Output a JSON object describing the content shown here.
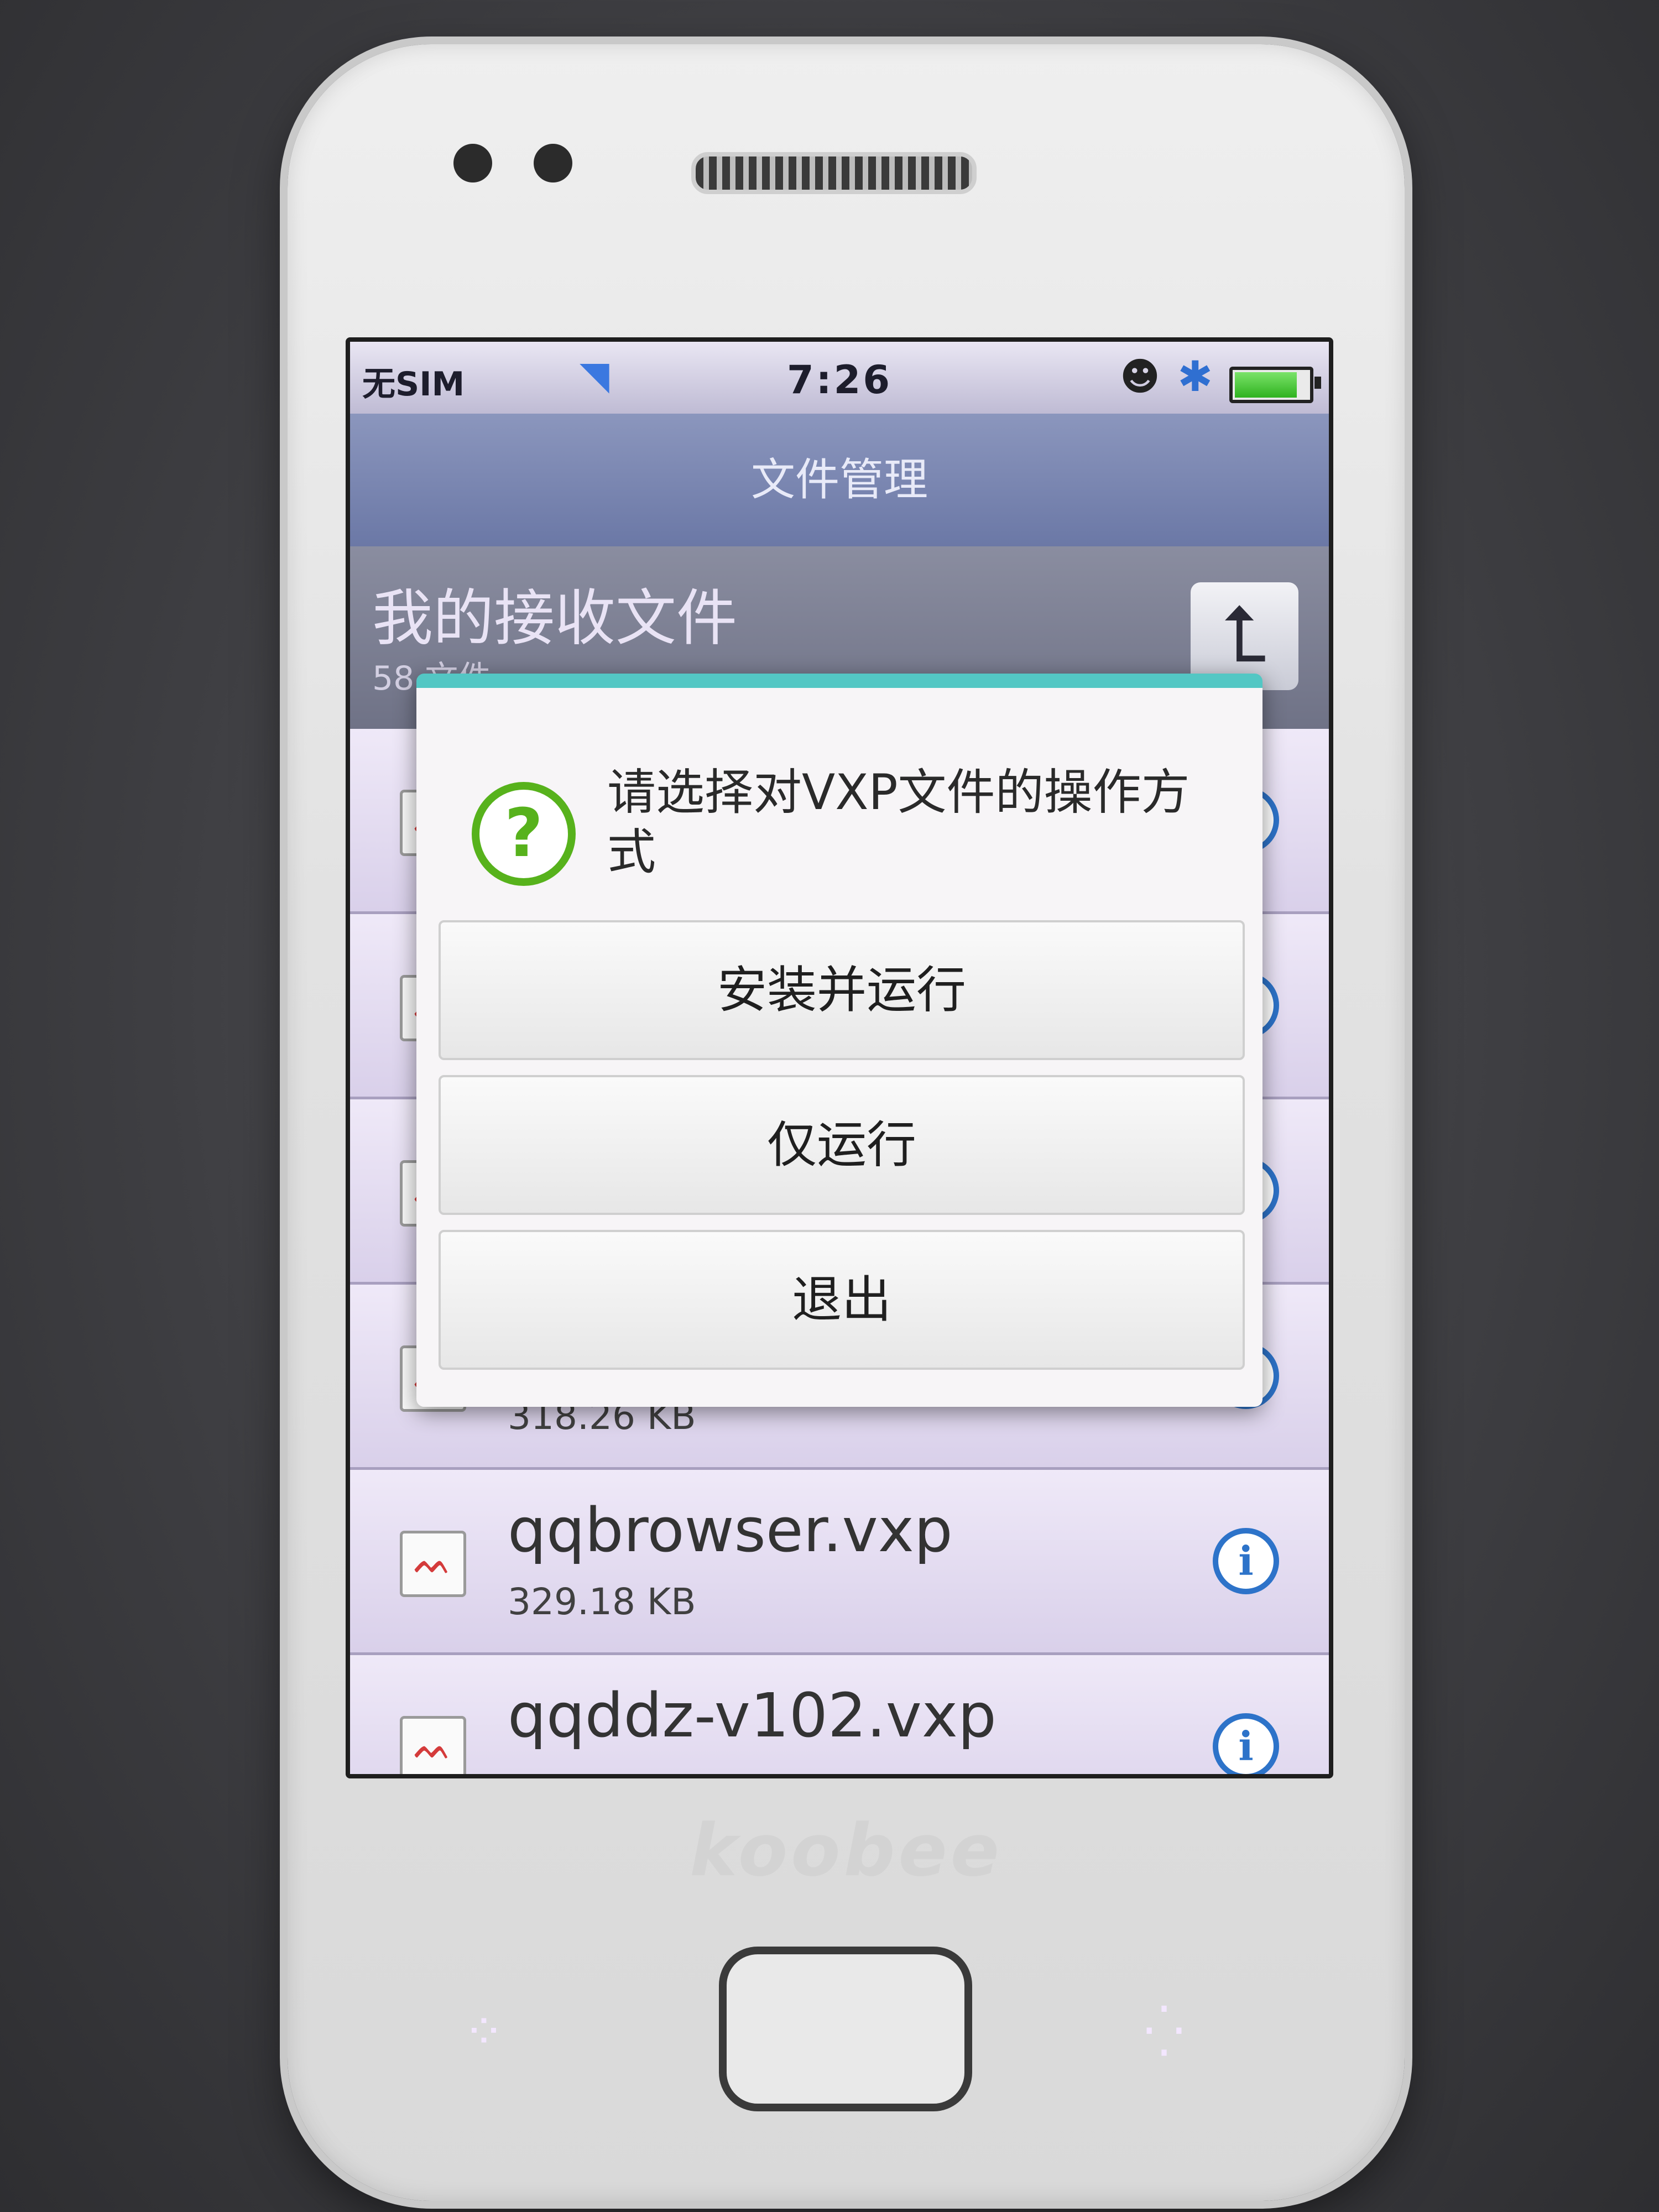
{
  "status_bar": {
    "carrier": "无SIM",
    "time": "7:26",
    "icons": [
      "wifi-icon",
      "qq-icon",
      "bluetooth-icon",
      "battery-icon"
    ]
  },
  "app": {
    "title": "文件管理"
  },
  "folder": {
    "name": "我的接收文件",
    "count": "58 文件"
  },
  "files": [
    {
      "name": "",
      "size": ""
    },
    {
      "name": "",
      "size": ""
    },
    {
      "name": "",
      "size": ""
    },
    {
      "name": "",
      "size": "318.26 KB"
    },
    {
      "name": "qqbrowser.vxp",
      "size": "329.18 KB"
    },
    {
      "name": "qqddz-v102.vxp",
      "size": ""
    }
  ],
  "dialog": {
    "message": "请选择对VXP文件的操作方式",
    "buttons": {
      "install_run": "安装并运行",
      "run_only": "仅运行",
      "exit": "退出"
    }
  },
  "device": {
    "brand": "koobee"
  },
  "colors": {
    "dialog_accent": "#53c7c4",
    "question_icon": "#57b21c",
    "info_icon": "#2d73c9"
  }
}
